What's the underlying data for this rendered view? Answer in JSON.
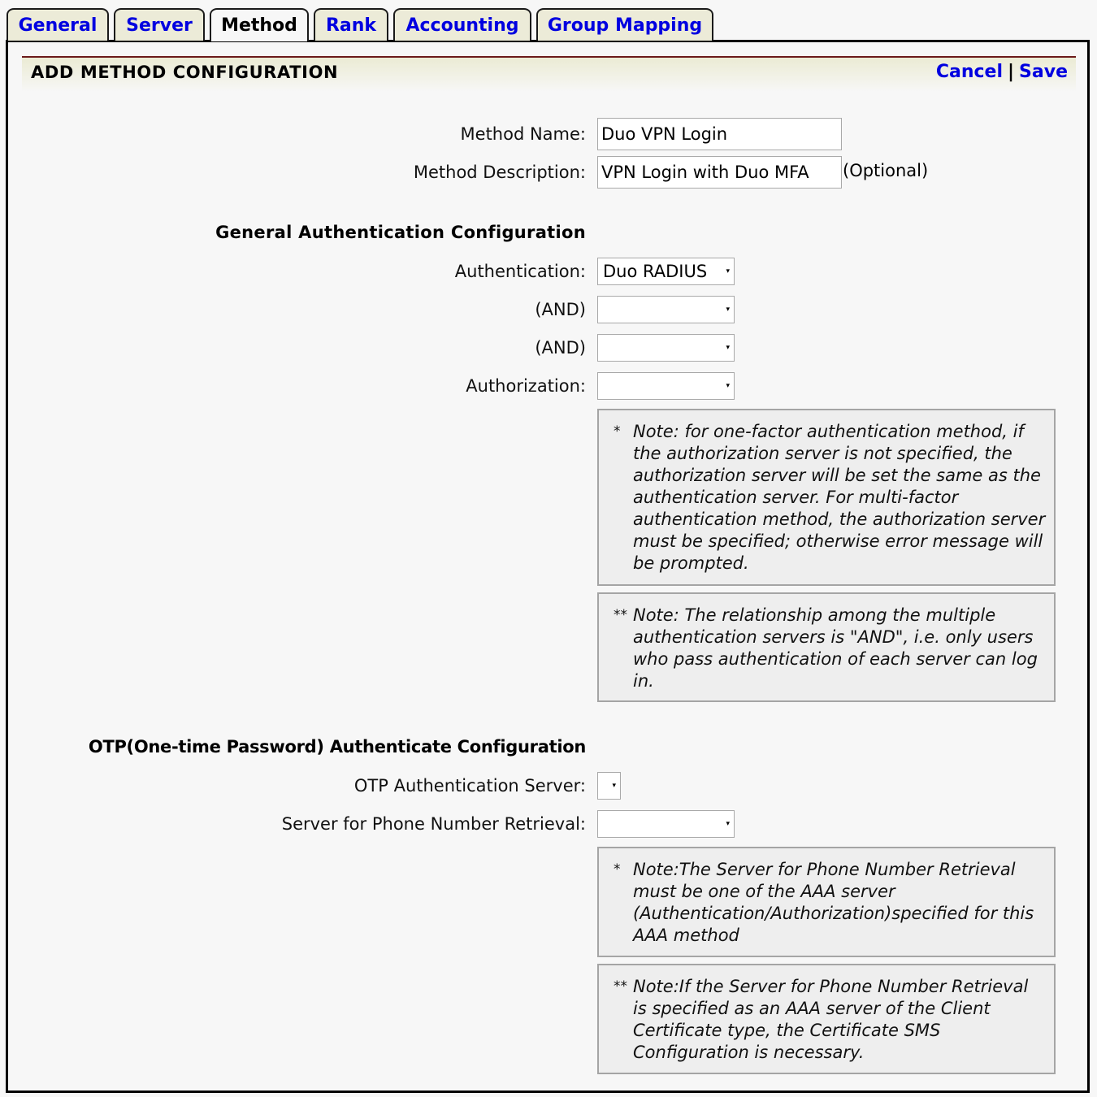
{
  "tabs": [
    {
      "label": "General",
      "active": false
    },
    {
      "label": "Server",
      "active": false
    },
    {
      "label": "Method",
      "active": true
    },
    {
      "label": "Rank",
      "active": false
    },
    {
      "label": "Accounting",
      "active": false
    },
    {
      "label": "Group Mapping",
      "active": false
    }
  ],
  "header": {
    "title": "ADD METHOD CONFIGURATION",
    "cancel_label": "Cancel",
    "separator": "|",
    "save_label": "Save"
  },
  "method": {
    "name_label": "Method Name:",
    "name_value": "Duo VPN Login",
    "description_label": "Method Description:",
    "description_value": "VPN Login with Duo MFA",
    "optional_label": "(Optional)"
  },
  "general_auth": {
    "heading": "General Authentication Configuration",
    "authentication_label": "Authentication:",
    "authentication_value": "Duo RADIUS",
    "and1_label": "(AND)",
    "and1_value": "",
    "and2_label": "(AND)",
    "and2_value": "",
    "authorization_label": "Authorization:",
    "authorization_value": "",
    "note1_mark": "*",
    "note1_text": "Note: for one-factor authentication method, if the authorization server is not specified, the authorization server will be set the same as the authentication server. For multi-factor authentication method, the authorization server must be specified; otherwise error message will be prompted.",
    "note2_mark": "**",
    "note2_text": "Note: The relationship among the multiple authentication servers is \"AND\", i.e. only users who pass authentication of each server can log in."
  },
  "otp": {
    "heading": "OTP(One-time Password) Authenticate Configuration",
    "otp_server_label": "OTP Authentication Server:",
    "otp_server_value": "",
    "phone_server_label": "Server for Phone Number Retrieval:",
    "phone_server_value": "",
    "note1_mark": "*",
    "note1_text": "Note:The Server for Phone Number Retrieval must be one of the AAA server (Authentication/Authorization)specified for this AAA method",
    "note2_mark": "**",
    "note2_text": "Note:If the Server for Phone Number Retrieval is specified as an AAA server of the Client Certificate type, the Certificate SMS Configuration is necessary."
  },
  "icons": {
    "dropdown_arrow": "▾"
  }
}
